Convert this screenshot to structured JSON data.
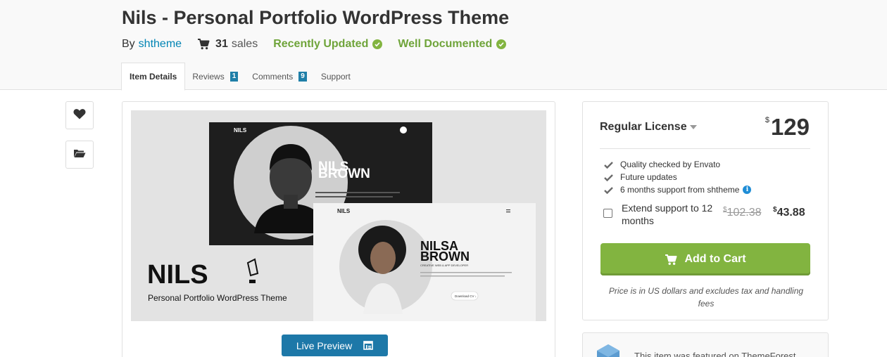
{
  "item": {
    "title": "Nils - Personal Portfolio WordPress Theme",
    "by_label": "By",
    "author": "shtheme",
    "sales_count": "31",
    "sales_label": "sales",
    "badge_updated": "Recently Updated",
    "badge_documented": "Well Documented"
  },
  "tabs": [
    {
      "label": "Item Details",
      "count": ""
    },
    {
      "label": "Reviews",
      "count": "1"
    },
    {
      "label": "Comments",
      "count": "9"
    },
    {
      "label": "Support",
      "count": ""
    }
  ],
  "preview": {
    "brand": "NILS",
    "tagline": "Personal  Portfolio  WordPress Theme",
    "dark_name_1": "NILS",
    "dark_name_2": "BROWN",
    "light_name_1": "NILSA",
    "light_name_2": "BROWN",
    "light_role": "CREATIVE WEB & APP DEVELOPER",
    "download_label": "Download CV ↓",
    "live_preview": "Live Preview"
  },
  "purchase": {
    "license": "Regular License",
    "currency": "$",
    "price": "129",
    "features": [
      "Quality checked by Envato",
      "Future updates",
      "6 months support from shtheme"
    ],
    "extend_label": "Extend support to 12 months",
    "extend_old_price": "102.38",
    "extend_new_price": "43.88",
    "add_to_cart": "Add to Cart",
    "note": "Price is in US dollars and excludes tax and handling fees"
  },
  "featured": {
    "text": "This item was featured on ThemeForest"
  },
  "colors": {
    "accent_green": "#82b440",
    "link_blue": "#0084b4",
    "button_blue": "#1d78a8",
    "badge_green": "#6fa43a"
  },
  "icons": [
    "heart-icon",
    "folder-icon",
    "cart-icon",
    "check-icon",
    "info-icon",
    "layout-icon"
  ]
}
